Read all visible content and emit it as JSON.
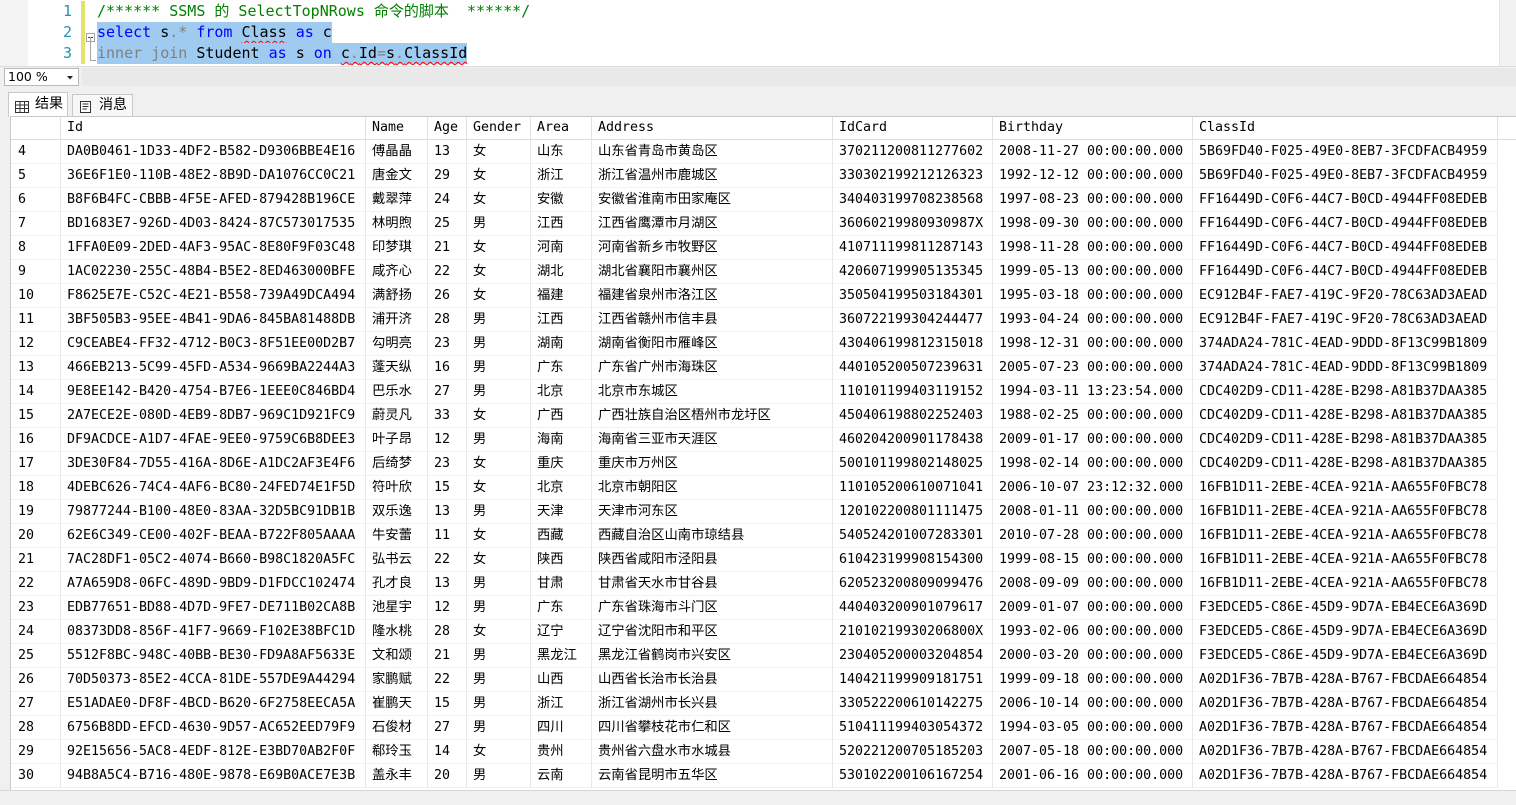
{
  "theme": {
    "comment": "#008000",
    "keyword": "#0000FF",
    "operator": "#808080",
    "ident": "#000000",
    "ws": "#000000",
    "line_number": "#2B91AF",
    "selection": "#9FCBF0",
    "squiggle": "#FF0000",
    "change_bar": "#E3E36A"
  },
  "editor": {
    "lines": [
      {
        "number": "1",
        "selected": false,
        "tokens": [
          {
            "t": "/****** SSMS 的 SelectTopNRows 命令的脚本  ******/",
            "k": "comment"
          }
        ]
      },
      {
        "number": "2",
        "selected": true,
        "tokens": [
          {
            "t": "select",
            "k": "keyword"
          },
          {
            "t": " ",
            "k": "ws"
          },
          {
            "t": "s",
            "k": "ident"
          },
          {
            "t": ".*",
            "k": "operator"
          },
          {
            "t": " ",
            "k": "ws"
          },
          {
            "t": "from",
            "k": "keyword"
          },
          {
            "t": " ",
            "k": "ws"
          },
          {
            "t": "Class",
            "k": "ident",
            "squiggle": true
          },
          {
            "t": " ",
            "k": "ws"
          },
          {
            "t": "as",
            "k": "keyword"
          },
          {
            "t": " ",
            "k": "ws"
          },
          {
            "t": "c",
            "k": "ident"
          }
        ]
      },
      {
        "number": "3",
        "selected": true,
        "tokens": [
          {
            "t": "inner",
            "k": "operator"
          },
          {
            "t": " ",
            "k": "ws"
          },
          {
            "t": "join",
            "k": "operator"
          },
          {
            "t": " ",
            "k": "ws"
          },
          {
            "t": "Student",
            "k": "ident"
          },
          {
            "t": " ",
            "k": "ws"
          },
          {
            "t": "as",
            "k": "keyword"
          },
          {
            "t": " ",
            "k": "ws"
          },
          {
            "t": "s",
            "k": "ident"
          },
          {
            "t": " ",
            "k": "ws"
          },
          {
            "t": "on",
            "k": "keyword"
          },
          {
            "t": " ",
            "k": "ws"
          },
          {
            "t": "c",
            "k": "ident",
            "squiggle": true
          },
          {
            "t": ".",
            "k": "operator",
            "squiggle": true
          },
          {
            "t": "Id",
            "k": "ident",
            "squiggle": true
          },
          {
            "t": "=",
            "k": "operator",
            "squiggle": true
          },
          {
            "t": "s",
            "k": "ident",
            "squiggle": true
          },
          {
            "t": ".",
            "k": "operator",
            "squiggle": true
          },
          {
            "t": "ClassId",
            "k": "ident",
            "squiggle": true
          }
        ]
      }
    ]
  },
  "zoom": {
    "value": "100 %"
  },
  "tabs": [
    {
      "label": "结果",
      "icon": "grid-icon",
      "active": true
    },
    {
      "label": "消息",
      "icon": "message-icon",
      "active": false
    }
  ],
  "grid": {
    "columns": [
      "Id",
      "Name",
      "Age",
      "Gender",
      "Area",
      "Address",
      "IdCard",
      "Birthday",
      "ClassId"
    ],
    "rows": [
      [
        "4",
        "DA0B0461-1D33-4DF2-B582-D9306BBE4E16",
        "傅晶晶",
        "13",
        "女",
        "山东",
        "山东省青岛市黄岛区",
        "370211200811277602",
        "2008-11-27 00:00:00.000",
        "5B69FD40-F025-49E0-8EB7-3FCDFACB4959"
      ],
      [
        "5",
        "36E6F1E0-110B-48E2-8B9D-DA1076CC0C21",
        "唐金文",
        "29",
        "女",
        "浙江",
        "浙江省温州市鹿城区",
        "330302199212126323",
        "1992-12-12 00:00:00.000",
        "5B69FD40-F025-49E0-8EB7-3FCDFACB4959"
      ],
      [
        "6",
        "B8F6B4FC-CBBB-4F5E-AFED-879428B196CE",
        "戴翠萍",
        "24",
        "女",
        "安徽",
        "安徽省淮南市田家庵区",
        "340403199708238568",
        "1997-08-23 00:00:00.000",
        "FF16449D-C0F6-44C7-B0CD-4944FF08EDEB"
      ],
      [
        "7",
        "BD1683E7-926D-4D03-8424-87C573017535",
        "林明煦",
        "25",
        "男",
        "江西",
        "江西省鹰潭市月湖区",
        "36060219980930987X",
        "1998-09-30 00:00:00.000",
        "FF16449D-C0F6-44C7-B0CD-4944FF08EDEB"
      ],
      [
        "8",
        "1FFA0E09-2DED-4AF3-95AC-8E80F9F03C48",
        "印梦琪",
        "21",
        "女",
        "河南",
        "河南省新乡市牧野区",
        "410711199811287143",
        "1998-11-28 00:00:00.000",
        "FF16449D-C0F6-44C7-B0CD-4944FF08EDEB"
      ],
      [
        "9",
        "1AC02230-255C-48B4-B5E2-8ED463000BFE",
        "咸齐心",
        "22",
        "女",
        "湖北",
        "湖北省襄阳市襄州区",
        "420607199905135345",
        "1999-05-13 00:00:00.000",
        "FF16449D-C0F6-44C7-B0CD-4944FF08EDEB"
      ],
      [
        "10",
        "F8625E7E-C52C-4E21-B558-739A49DCA494",
        "满舒扬",
        "26",
        "女",
        "福建",
        "福建省泉州市洛江区",
        "350504199503184301",
        "1995-03-18 00:00:00.000",
        "EC912B4F-FAE7-419C-9F20-78C63AD3AEAD"
      ],
      [
        "11",
        "3BF505B3-95EE-4B41-9DA6-845BA81488DB",
        "浦开济",
        "28",
        "男",
        "江西",
        "江西省赣州市信丰县",
        "360722199304244477",
        "1993-04-24 00:00:00.000",
        "EC912B4F-FAE7-419C-9F20-78C63AD3AEAD"
      ],
      [
        "12",
        "C9CEABE4-FF32-4712-B0C3-8F51EE00D2B7",
        "勾明亮",
        "23",
        "男",
        "湖南",
        "湖南省衡阳市雁峰区",
        "430406199812315018",
        "1998-12-31 00:00:00.000",
        "374ADA24-781C-4EAD-9DDD-8F13C99B1809"
      ],
      [
        "13",
        "466EB213-5C99-45FD-A534-9669BA2244A3",
        "蓬天纵",
        "16",
        "男",
        "广东",
        "广东省广州市海珠区",
        "440105200507239631",
        "2005-07-23 00:00:00.000",
        "374ADA24-781C-4EAD-9DDD-8F13C99B1809"
      ],
      [
        "14",
        "9E8EE142-B420-4754-B7E6-1EEE0C846BD4",
        "巴乐水",
        "27",
        "男",
        "北京",
        "北京市东城区",
        "110101199403119152",
        "1994-03-11 13:23:54.000",
        "CDC402D9-CD11-428E-B298-A81B37DAA385"
      ],
      [
        "15",
        "2A7ECE2E-080D-4EB9-8DB7-969C1D921FC9",
        "蔚灵凡",
        "33",
        "女",
        "广西",
        "广西壮族自治区梧州市龙圩区",
        "450406198802252403",
        "1988-02-25 00:00:00.000",
        "CDC402D9-CD11-428E-B298-A81B37DAA385"
      ],
      [
        "16",
        "DF9ACDCE-A1D7-4FAE-9EE0-9759C6B8DEE3",
        "叶子昂",
        "12",
        "男",
        "海南",
        "海南省三亚市天涯区",
        "460204200901178438",
        "2009-01-17 00:00:00.000",
        "CDC402D9-CD11-428E-B298-A81B37DAA385"
      ],
      [
        "17",
        "3DE30F84-7D55-416A-8D6E-A1DC2AF3E4F6",
        "后绮梦",
        "23",
        "女",
        "重庆",
        "重庆市万州区",
        "500101199802148025",
        "1998-02-14 00:00:00.000",
        "CDC402D9-CD11-428E-B298-A81B37DAA385"
      ],
      [
        "18",
        "4DEBC626-74C4-4AF6-BC80-24FED74E1F5D",
        "符叶欣",
        "15",
        "女",
        "北京",
        "北京市朝阳区",
        "110105200610071041",
        "2006-10-07 23:12:32.000",
        "16FB1D11-2EBE-4CEA-921A-AA655F0FBC78"
      ],
      [
        "19",
        "79877244-B100-48E0-83AA-32D5BC91DB1B",
        "双乐逸",
        "13",
        "男",
        "天津",
        "天津市河东区",
        "120102200801111475",
        "2008-01-11 00:00:00.000",
        "16FB1D11-2EBE-4CEA-921A-AA655F0FBC78"
      ],
      [
        "20",
        "62E6C349-CE00-402F-BEAA-B722F805AAAA",
        "牛安蕾",
        "11",
        "女",
        "西藏",
        "西藏自治区山南市琼结县",
        "540524201007283301",
        "2010-07-28 00:00:00.000",
        "16FB1D11-2EBE-4CEA-921A-AA655F0FBC78"
      ],
      [
        "21",
        "7AC28DF1-05C2-4074-B660-B98C1820A5FC",
        "弘书云",
        "22",
        "女",
        "陕西",
        "陕西省咸阳市泾阳县",
        "610423199908154300",
        "1999-08-15 00:00:00.000",
        "16FB1D11-2EBE-4CEA-921A-AA655F0FBC78"
      ],
      [
        "22",
        "A7A659D8-06FC-489D-9BD9-D1FDCC102474",
        "孔才良",
        "13",
        "男",
        "甘肃",
        "甘肃省天水市甘谷县",
        "620523200809099476",
        "2008-09-09 00:00:00.000",
        "16FB1D11-2EBE-4CEA-921A-AA655F0FBC78"
      ],
      [
        "23",
        "EDB77651-BD88-4D7D-9FE7-DE711B02CA8B",
        "池星宇",
        "12",
        "男",
        "广东",
        "广东省珠海市斗门区",
        "440403200901079617",
        "2009-01-07 00:00:00.000",
        "F3EDCED5-C86E-45D9-9D7A-EB4ECE6A369D"
      ],
      [
        "24",
        "08373DD8-856F-41F7-9669-F102E38BFC1D",
        "隆水桃",
        "28",
        "女",
        "辽宁",
        "辽宁省沈阳市和平区",
        "21010219930206800X",
        "1993-02-06 00:00:00.000",
        "F3EDCED5-C86E-45D9-9D7A-EB4ECE6A369D"
      ],
      [
        "25",
        "5512F8BC-948C-40BB-BE30-FD9A8AF5633E",
        "文和颂",
        "21",
        "男",
        "黑龙江",
        "黑龙江省鹤岗市兴安区",
        "230405200003204854",
        "2000-03-20 00:00:00.000",
        "F3EDCED5-C86E-45D9-9D7A-EB4ECE6A369D"
      ],
      [
        "26",
        "70D50373-85E2-4CCA-81DE-557DE9A44294",
        "家鹏赋",
        "22",
        "男",
        "山西",
        "山西省长治市长治县",
        "140421199909181751",
        "1999-09-18 00:00:00.000",
        "A02D1F36-7B7B-428A-B767-FBCDAE664854"
      ],
      [
        "27",
        "E51ADAE0-DF8F-4BCD-B620-6F2758EECA5A",
        "崔鹏天",
        "15",
        "男",
        "浙江",
        "浙江省湖州市长兴县",
        "330522200610142275",
        "2006-10-14 00:00:00.000",
        "A02D1F36-7B7B-428A-B767-FBCDAE664854"
      ],
      [
        "28",
        "6756B8DD-EFCD-4630-9D57-AC652EED79F9",
        "石俊材",
        "27",
        "男",
        "四川",
        "四川省攀枝花市仁和区",
        "510411199403054372",
        "1994-03-05 00:00:00.000",
        "A02D1F36-7B7B-428A-B767-FBCDAE664854"
      ],
      [
        "29",
        "92E15656-5AC8-4EDF-812E-E3BD70AB2F0F",
        "郗玲玉",
        "14",
        "女",
        "贵州",
        "贵州省六盘水市水城县",
        "520221200705185203",
        "2007-05-18 00:00:00.000",
        "A02D1F36-7B7B-428A-B767-FBCDAE664854"
      ],
      [
        "30",
        "94B8A5C4-B716-480E-9878-E69B0ACE7E3B",
        "盖永丰",
        "20",
        "男",
        "云南",
        "云南省昆明市五华区",
        "530102200106167254",
        "2001-06-16 00:00:00.000",
        "A02D1F36-7B7B-428A-B767-FBCDAE664854"
      ]
    ]
  }
}
